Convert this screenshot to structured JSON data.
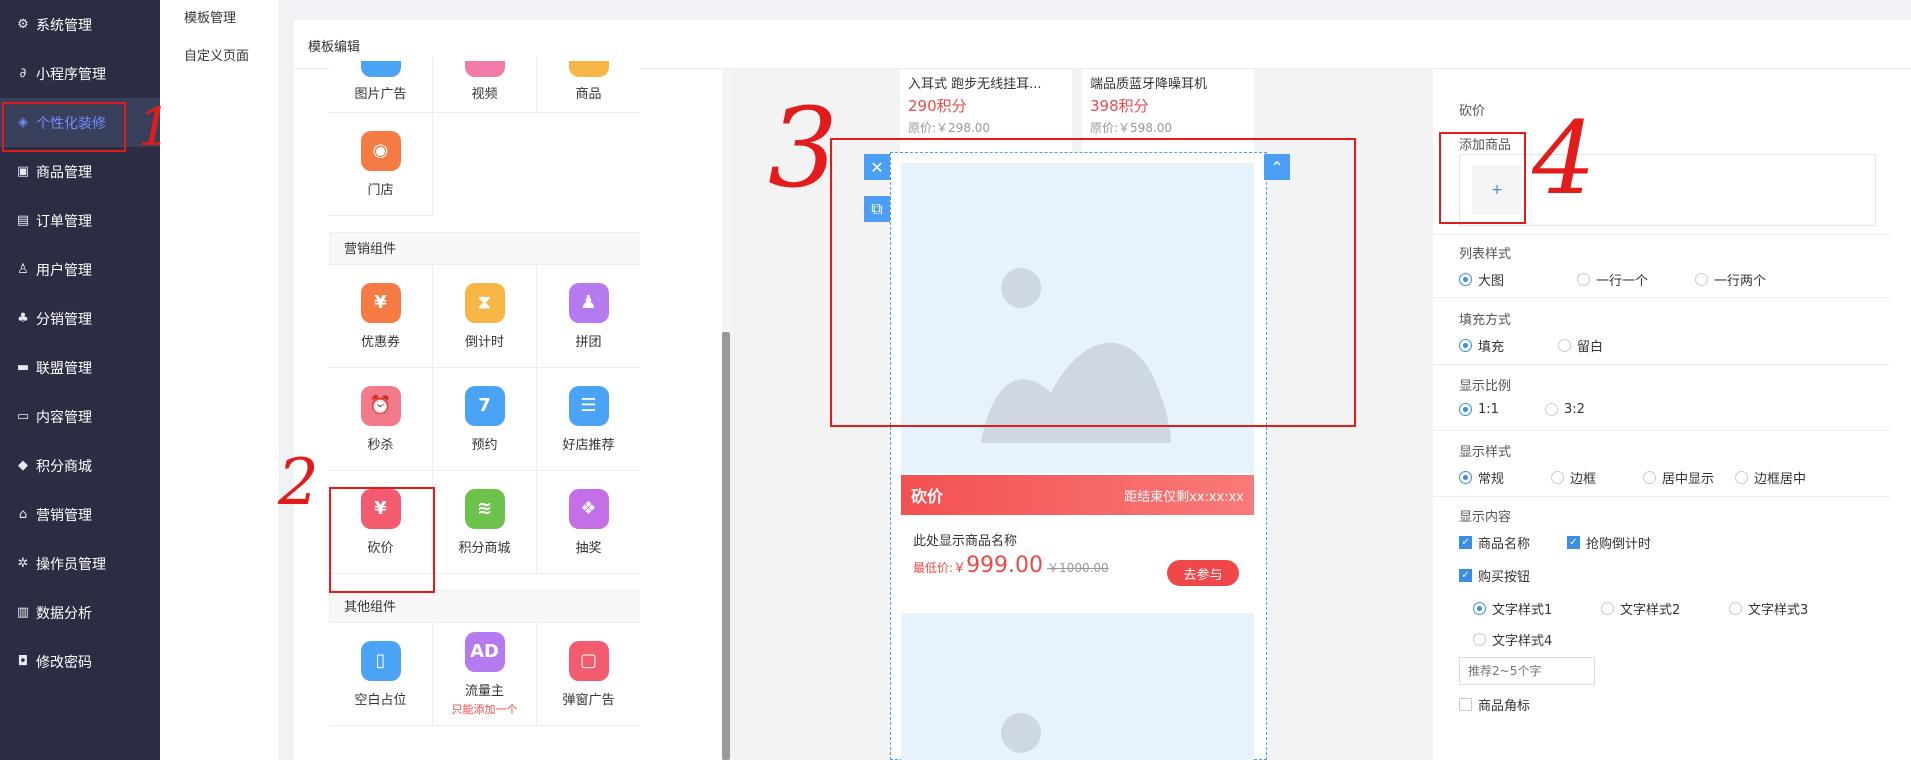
{
  "sidebar": {
    "items": [
      {
        "label": "系统管理",
        "icon": "gear-icon",
        "glyph": "⚙"
      },
      {
        "label": "小程序管理",
        "icon": "link-icon",
        "glyph": "∂"
      },
      {
        "label": "个性化装修",
        "icon": "diamond-icon",
        "glyph": "◈"
      },
      {
        "label": "商品管理",
        "icon": "bag-icon",
        "glyph": "▣"
      },
      {
        "label": "订单管理",
        "icon": "list-icon",
        "glyph": "▤"
      },
      {
        "label": "用户管理",
        "icon": "user-icon",
        "glyph": "♙"
      },
      {
        "label": "分销管理",
        "icon": "network-icon",
        "glyph": "♣"
      },
      {
        "label": "联盟管理",
        "icon": "store-icon",
        "glyph": "▬"
      },
      {
        "label": "内容管理",
        "icon": "content-icon",
        "glyph": "▭"
      },
      {
        "label": "积分商城",
        "icon": "cube-icon",
        "glyph": "◆"
      },
      {
        "label": "营销管理",
        "icon": "marketing-icon",
        "glyph": "⌂"
      },
      {
        "label": "操作员管理",
        "icon": "settings-icon",
        "glyph": "✲"
      },
      {
        "label": "数据分析",
        "icon": "chart-icon",
        "glyph": "▥"
      },
      {
        "label": "修改密码",
        "icon": "shield-icon",
        "glyph": "◘"
      }
    ]
  },
  "submenu": {
    "items": [
      {
        "label": "模板管理"
      },
      {
        "label": "自定义页面"
      }
    ]
  },
  "panel": {
    "title": "模板编辑"
  },
  "library": {
    "top_row": [
      {
        "label": "图片广告",
        "color": "#4aa3f5"
      },
      {
        "label": "视频",
        "color": "#f27aa8"
      },
      {
        "label": "商品",
        "color": "#f7b545"
      }
    ],
    "store": {
      "label": "门店",
      "color": "#f57b45",
      "glyph": "◉"
    },
    "marketing_title": "营销组件",
    "marketing": [
      {
        "label": "优惠券",
        "color": "#f57b45",
        "glyph": "¥"
      },
      {
        "label": "倒计时",
        "color": "#f7b545",
        "glyph": "⧗"
      },
      {
        "label": "拼团",
        "color": "#b57af0",
        "glyph": "♟"
      },
      {
        "label": "秒杀",
        "color": "#f27a8a",
        "glyph": "⏰"
      },
      {
        "label": "预约",
        "color": "#4aa3f5",
        "glyph": "7"
      },
      {
        "label": "好店推荐",
        "color": "#4aa3f5",
        "glyph": "☰"
      },
      {
        "label": "砍价",
        "color": "#f25c6e",
        "glyph": "¥"
      },
      {
        "label": "积分商城",
        "color": "#6cc24a",
        "glyph": "≋"
      },
      {
        "label": "抽奖",
        "color": "#c46ee8",
        "glyph": "❖"
      }
    ],
    "other_title": "其他组件",
    "other": [
      {
        "label": "空白占位",
        "color": "#4aa3f5",
        "glyph": "▯"
      },
      {
        "label": "流量主",
        "color": "#b57af0",
        "glyph": "AD",
        "note": "只能添加一个"
      },
      {
        "label": "弹窗广告",
        "color": "#f25c6e",
        "glyph": "▢"
      }
    ]
  },
  "preview": {
    "cards": [
      {
        "name": "入耳式 跑步无线挂耳...",
        "price": "290积分",
        "orig": "原价:￥298.00"
      },
      {
        "name": "端品质蓝牙降噪耳机",
        "price": "398积分",
        "orig": "原价:￥598.00"
      }
    ],
    "bargain": {
      "bar_title": "砍价",
      "countdown": "距结束仅剩xx:xx:xx",
      "product_name": "此处显示商品名称",
      "price_label": "最低价:",
      "currency": "￥",
      "price": "999.00",
      "orig_price": "￥1000.00",
      "join": "去参与"
    },
    "tools": {
      "close": "✕",
      "copy": "⧉",
      "up": "⌃"
    }
  },
  "annotations": {
    "n1": "1",
    "n2": "2",
    "n3": "3",
    "n4": "4"
  },
  "config": {
    "title": "砍价",
    "add_goods": "添加商品",
    "add_plus": "+",
    "list_style": {
      "label": "列表样式",
      "options": [
        "大图",
        "一行一个",
        "一行两个"
      ],
      "selected": 0
    },
    "fill_mode": {
      "label": "填充方式",
      "options": [
        "填充",
        "留白"
      ],
      "selected": 0
    },
    "ratio": {
      "label": "显示比例",
      "options": [
        "1:1",
        "3:2"
      ],
      "selected": 0
    },
    "display_style": {
      "label": "显示样式",
      "options": [
        "常规",
        "边框",
        "居中显示",
        "边框居中"
      ],
      "selected": 0
    },
    "display_content": {
      "label": "显示内容",
      "checks": [
        {
          "label": "商品名称",
          "checked": true
        },
        {
          "label": "抢购倒计时",
          "checked": true
        },
        {
          "label": "购买按钮",
          "checked": true
        }
      ],
      "text_styles": [
        "文字样式1",
        "文字样式2",
        "文字样式3",
        "文字样式4"
      ],
      "text_style_selected": 0,
      "placeholder": "推荐2~5个字",
      "corner_tag": {
        "label": "商品角标",
        "checked": false
      }
    }
  }
}
